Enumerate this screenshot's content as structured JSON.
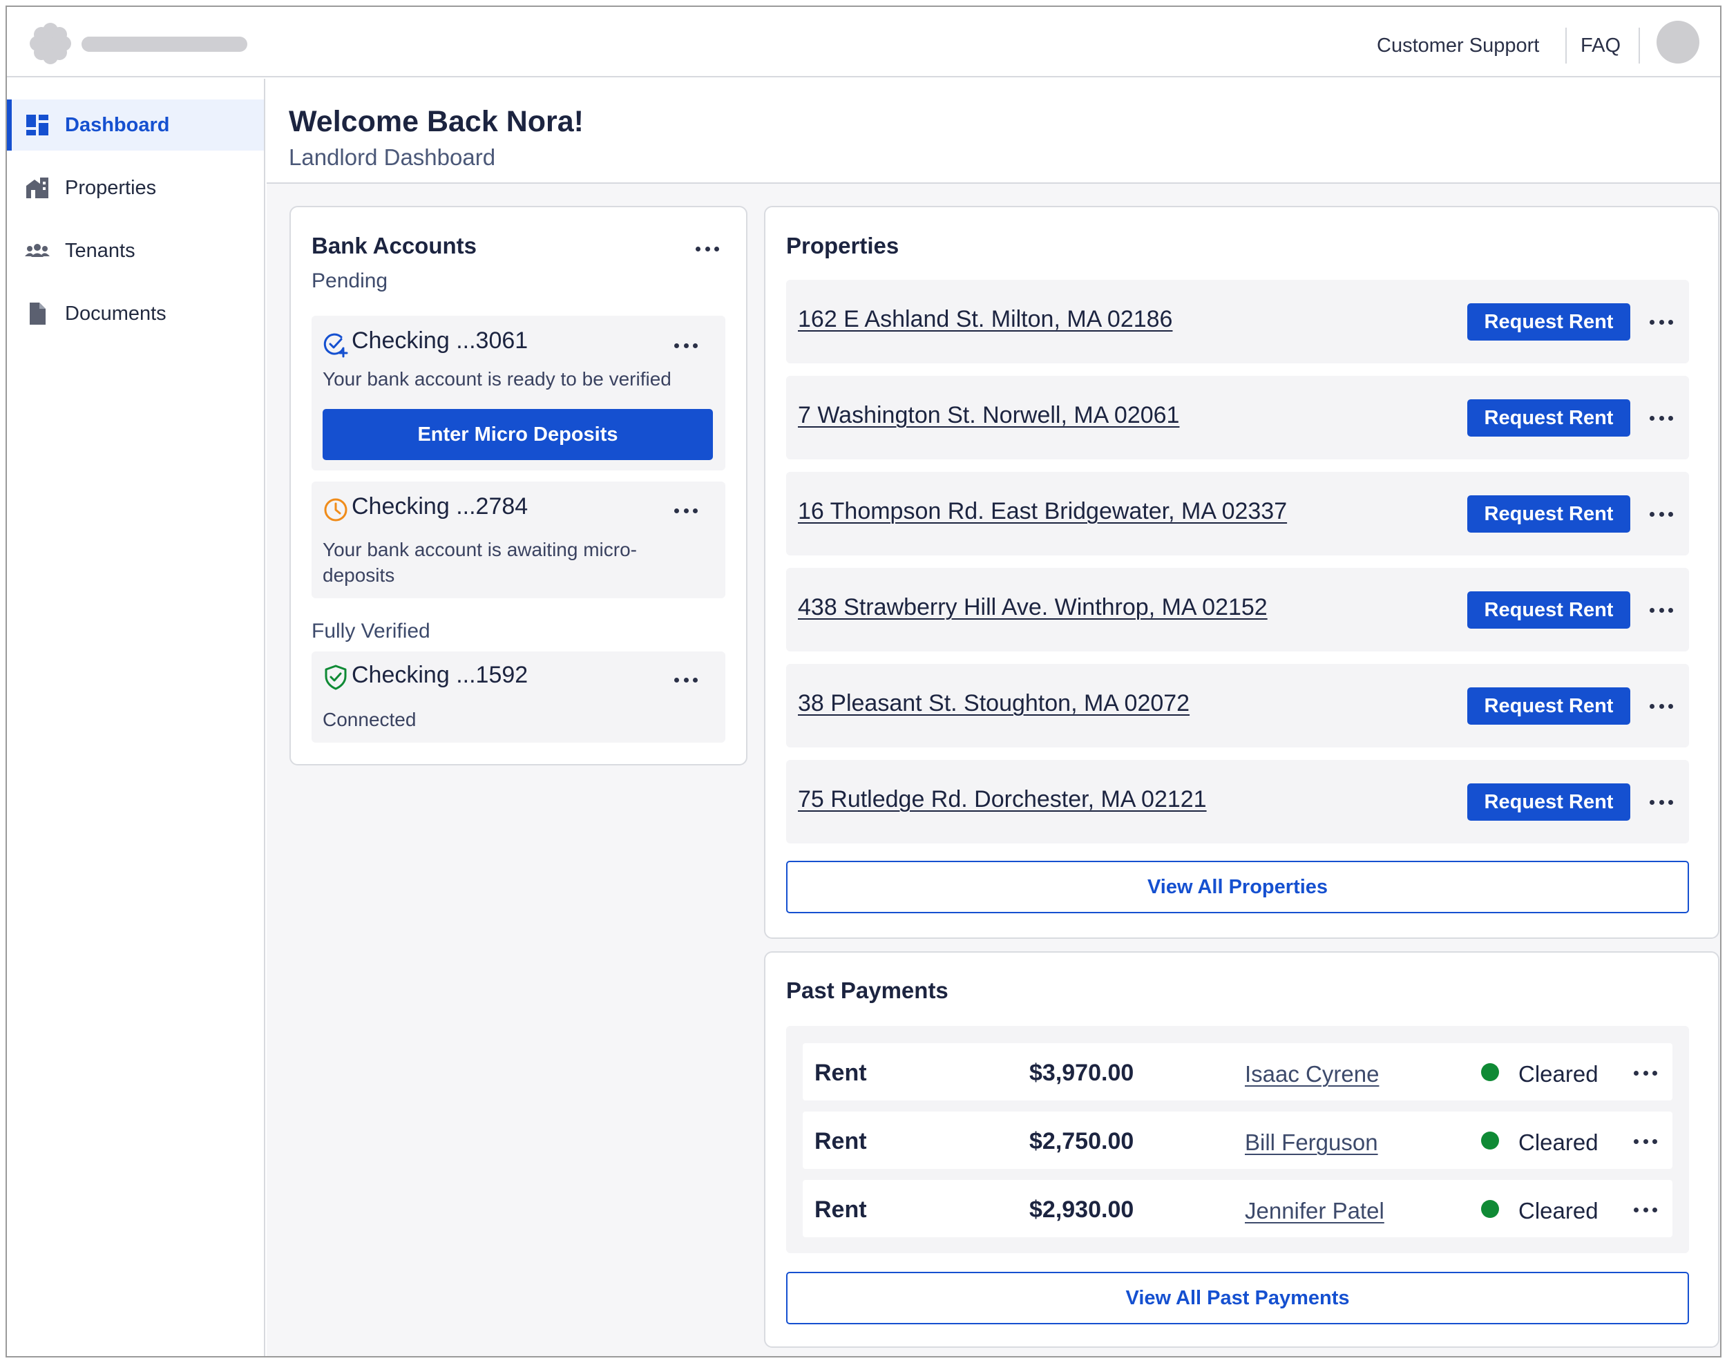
{
  "header": {
    "support_label": "Customer Support",
    "faq_label": "FAQ"
  },
  "sidebar": {
    "items": [
      {
        "label": "Dashboard",
        "icon": "dashboard-icon",
        "active": true
      },
      {
        "label": "Properties",
        "icon": "building-icon",
        "active": false
      },
      {
        "label": "Tenants",
        "icon": "people-icon",
        "active": false
      },
      {
        "label": "Documents",
        "icon": "document-icon",
        "active": false
      }
    ]
  },
  "page": {
    "title": "Welcome Back Nora!",
    "subtitle": "Landlord Dashboard"
  },
  "bank": {
    "title": "Bank Accounts",
    "pending_label": "Pending",
    "verified_label": "Fully Verified",
    "accounts": [
      {
        "name": "Checking ...3061",
        "desc": "Your bank account is ready to be verified",
        "icon": "check-clock-icon",
        "action": "Enter Micro Deposits"
      },
      {
        "name": "Checking ...2784",
        "desc": "Your bank account is awaiting micro-deposits",
        "icon": "clock-icon"
      },
      {
        "name": "Checking ...1592",
        "desc": "Connected",
        "icon": "shield-check-icon"
      }
    ]
  },
  "properties": {
    "title": "Properties",
    "button_label": "Request Rent",
    "view_all": "View All Properties",
    "items": [
      "162 E Ashland St. Milton, MA 02186",
      "7 Washington St. Norwell, MA 02061",
      "16 Thompson Rd. East Bridgewater, MA 02337",
      "438 Strawberry Hill Ave. Winthrop, MA 02152",
      "38 Pleasant St. Stoughton, MA 02072",
      "75 Rutledge Rd. Dorchester, MA 02121"
    ]
  },
  "payments": {
    "title": "Past Payments",
    "view_all": "View All Past Payments",
    "rows": [
      {
        "type": "Rent",
        "amount": "$3,970.00",
        "tenant": "Isaac Cyrene",
        "status": "Cleared"
      },
      {
        "type": "Rent",
        "amount": "$2,750.00",
        "tenant": "Bill Ferguson",
        "status": "Cleared"
      },
      {
        "type": "Rent",
        "amount": "$2,930.00",
        "tenant": "Jennifer Patel",
        "status": "Cleared"
      }
    ]
  },
  "colors": {
    "accent": "#1550d0",
    "success": "#0f8a35",
    "warning": "#f08c1a"
  }
}
